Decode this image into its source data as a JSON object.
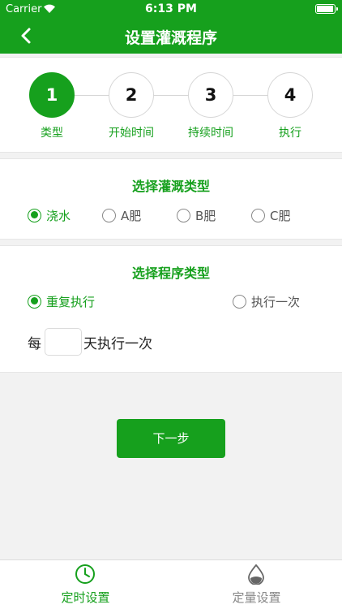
{
  "status_bar": {
    "carrier": "Carrier",
    "time": "6:13 PM",
    "battery_level": 1.0
  },
  "nav": {
    "title": "设置灌溉程序"
  },
  "steps": [
    {
      "number": "1",
      "label": "类型",
      "active": true
    },
    {
      "number": "2",
      "label": "开始时间",
      "active": false
    },
    {
      "number": "3",
      "label": "持续时间",
      "active": false
    },
    {
      "number": "4",
      "label": "执行",
      "active": false
    }
  ],
  "irrigation_type": {
    "title": "选择灌溉类型",
    "options": [
      {
        "label": "浇水",
        "selected": true
      },
      {
        "label": "A肥",
        "selected": false
      },
      {
        "label": "B肥",
        "selected": false
      },
      {
        "label": "C肥",
        "selected": false
      }
    ]
  },
  "program_type": {
    "title": "选择程序类型",
    "options": [
      {
        "label": "重复执行",
        "selected": true
      },
      {
        "label": "执行一次",
        "selected": false
      }
    ],
    "interval_prefix": "每",
    "interval_value": "",
    "interval_suffix": "天执行一次"
  },
  "next_button": "下一步",
  "tabs": [
    {
      "label": "定时设置",
      "icon": "clock-icon",
      "active": true
    },
    {
      "label": "定量设置",
      "icon": "water-drop-icon",
      "active": false
    }
  ],
  "colors": {
    "accent": "#16a01d",
    "background": "#f2f2f2",
    "inactive": "#888888"
  }
}
